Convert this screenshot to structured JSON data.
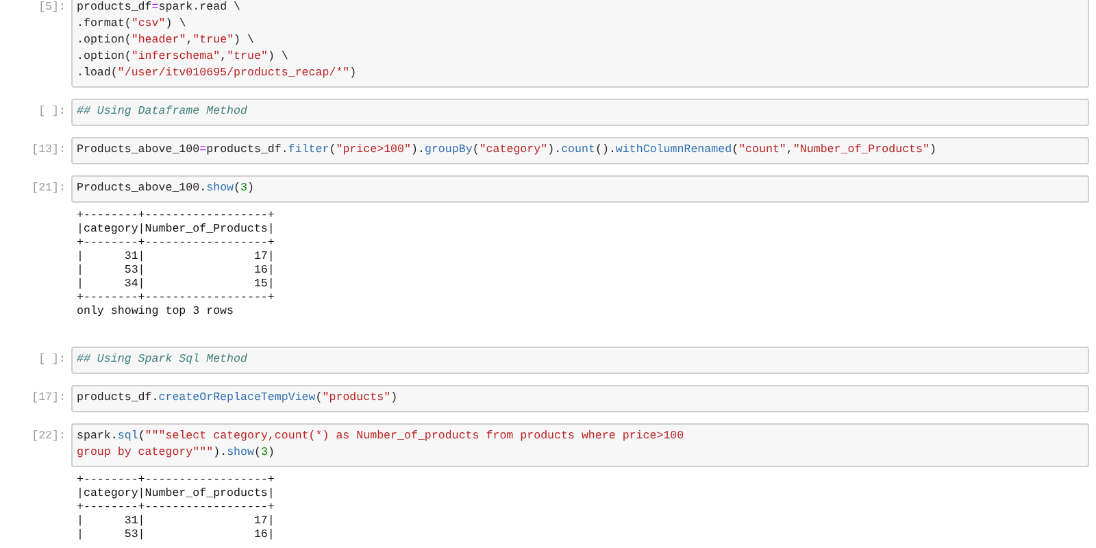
{
  "cells": [
    {
      "prompt": "[5]:",
      "lines": [
        [
          {
            "kind": "plain",
            "text": "products_df"
          },
          {
            "kind": "op",
            "text": "="
          },
          {
            "kind": "plain",
            "text": "spark.read \\"
          }
        ],
        [
          {
            "kind": "plain",
            "text": ".format("
          },
          {
            "kind": "string",
            "text": "\"csv\""
          },
          {
            "kind": "plain",
            "text": ") \\"
          }
        ],
        [
          {
            "kind": "plain",
            "text": ".option("
          },
          {
            "kind": "string",
            "text": "\"header\""
          },
          {
            "kind": "plain",
            "text": ","
          },
          {
            "kind": "string",
            "text": "\"true\""
          },
          {
            "kind": "plain",
            "text": ") \\"
          }
        ],
        [
          {
            "kind": "plain",
            "text": ".option("
          },
          {
            "kind": "string",
            "text": "\"inferschema\""
          },
          {
            "kind": "plain",
            "text": ","
          },
          {
            "kind": "string",
            "text": "\"true\""
          },
          {
            "kind": "plain",
            "text": ") \\"
          }
        ],
        [
          {
            "kind": "plain",
            "text": ".load("
          },
          {
            "kind": "string",
            "text": "\"/user/itv010695/products_recap/*\""
          },
          {
            "kind": "plain",
            "text": ")"
          }
        ]
      ]
    },
    {
      "prompt": "[ ]:",
      "lines": [
        [
          {
            "kind": "comment",
            "text": "## Using Dataframe Method"
          }
        ]
      ]
    },
    {
      "prompt": "[13]:",
      "lines": [
        [
          {
            "kind": "plain",
            "text": "Products_above_100"
          },
          {
            "kind": "op",
            "text": "="
          },
          {
            "kind": "plain",
            "text": "products_df."
          },
          {
            "kind": "method",
            "text": "filter"
          },
          {
            "kind": "plain",
            "text": "("
          },
          {
            "kind": "string",
            "text": "\"price>100\""
          },
          {
            "kind": "plain",
            "text": ")."
          },
          {
            "kind": "method",
            "text": "groupBy"
          },
          {
            "kind": "plain",
            "text": "("
          },
          {
            "kind": "string",
            "text": "\"category\""
          },
          {
            "kind": "plain",
            "text": ")."
          },
          {
            "kind": "method",
            "text": "count"
          },
          {
            "kind": "plain",
            "text": "()."
          },
          {
            "kind": "method",
            "text": "withColumnRenamed"
          },
          {
            "kind": "plain",
            "text": "("
          },
          {
            "kind": "string",
            "text": "\"count\""
          },
          {
            "kind": "plain",
            "text": ","
          },
          {
            "kind": "string",
            "text": "\"Number_of_Products\""
          },
          {
            "kind": "plain",
            "text": ")"
          }
        ]
      ]
    },
    {
      "prompt": "[21]:",
      "lines": [
        [
          {
            "kind": "plain",
            "text": "Products_above_100."
          },
          {
            "kind": "method",
            "text": "show"
          },
          {
            "kind": "plain",
            "text": "("
          },
          {
            "kind": "number",
            "text": "3"
          },
          {
            "kind": "plain",
            "text": ")"
          }
        ]
      ],
      "output": [
        "+--------+------------------+",
        "|category|Number_of_Products|",
        "+--------+------------------+",
        "|      31|                17|",
        "|      53|                16|",
        "|      34|                15|",
        "+--------+------------------+",
        "only showing top 3 rows"
      ]
    },
    {
      "prompt": "[ ]:",
      "lines": [
        [
          {
            "kind": "comment",
            "text": "## Using Spark Sql Method"
          }
        ]
      ]
    },
    {
      "prompt": "[17]:",
      "lines": [
        [
          {
            "kind": "plain",
            "text": "products_df."
          },
          {
            "kind": "method",
            "text": "createOrReplaceTempView"
          },
          {
            "kind": "plain",
            "text": "("
          },
          {
            "kind": "string",
            "text": "\"products\""
          },
          {
            "kind": "plain",
            "text": ")"
          }
        ]
      ]
    },
    {
      "prompt": "[22]:",
      "lines": [
        [
          {
            "kind": "plain",
            "text": "spark."
          },
          {
            "kind": "method",
            "text": "sql"
          },
          {
            "kind": "plain",
            "text": "("
          },
          {
            "kind": "string",
            "text": "\"\"\"select category,count(*) as Number_of_products from products where price>100"
          }
        ],
        [
          {
            "kind": "string",
            "text": "group by category\"\"\""
          },
          {
            "kind": "plain",
            "text": ")."
          },
          {
            "kind": "method",
            "text": "show"
          },
          {
            "kind": "plain",
            "text": "("
          },
          {
            "kind": "number",
            "text": "3"
          },
          {
            "kind": "plain",
            "text": ")"
          }
        ]
      ],
      "output": [
        "+--------+------------------+",
        "|category|Number_of_products|",
        "+--------+------------------+",
        "|      31|                17|",
        "|      53|                16|"
      ]
    }
  ]
}
